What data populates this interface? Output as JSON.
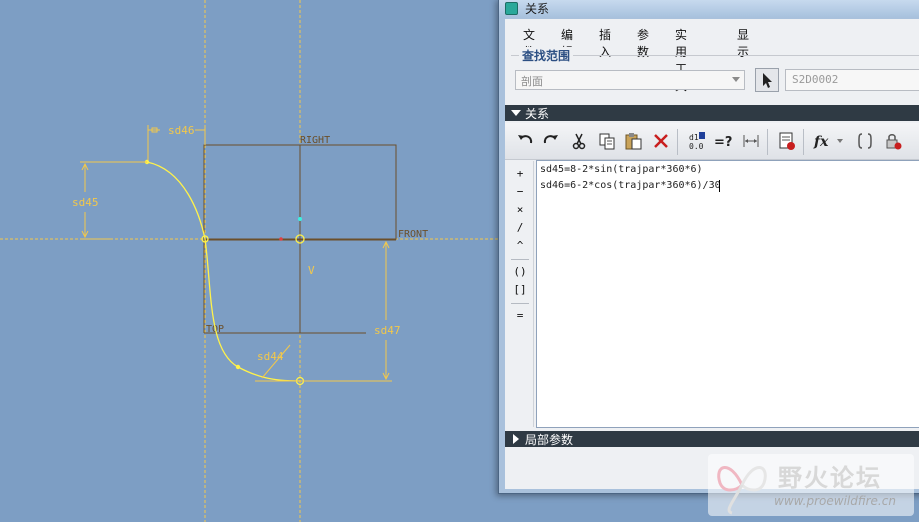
{
  "sketch": {
    "plane_labels": {
      "right": "RIGHT",
      "front": "FRONT",
      "top": "TOP"
    },
    "dimensions": {
      "sd46": "sd46",
      "sd45": "sd45",
      "sd47": "sd47",
      "sd44": "sd44"
    },
    "vertical_label": "V",
    "colors": {
      "background": "#7d9ec4",
      "datum": "#f2c84b",
      "plane": "#6b4f2a",
      "curve": "#fff24a"
    }
  },
  "dialog": {
    "title": "关系",
    "menu": [
      "文件",
      "编辑",
      "插入",
      "参数",
      "实用工具",
      "显示"
    ],
    "scope": {
      "title": "查找范围",
      "select_value": "剖面",
      "part_name": "S2D0002"
    },
    "relations_header": "关系",
    "toolbar_icons": [
      "undo-icon",
      "redo-icon",
      "cut-icon",
      "copy-icon",
      "paste-icon",
      "delete-icon",
      "evaluate-icon",
      "verify-icon",
      "dimension-icon",
      "sort-icon",
      "function-icon",
      "brackets-icon",
      "lock-icon"
    ],
    "operators": [
      "+",
      "−",
      "×",
      "/",
      "^",
      "()",
      "[]",
      "="
    ],
    "relations": [
      "sd45=8-2*sin(trajpar*360*6)",
      "sd46=6-2*cos(trajpar*360*6)/30"
    ],
    "local_params_header": "局部参数"
  },
  "watermark": {
    "cn": "野火论坛",
    "url": "www.proewildfire.cn"
  }
}
